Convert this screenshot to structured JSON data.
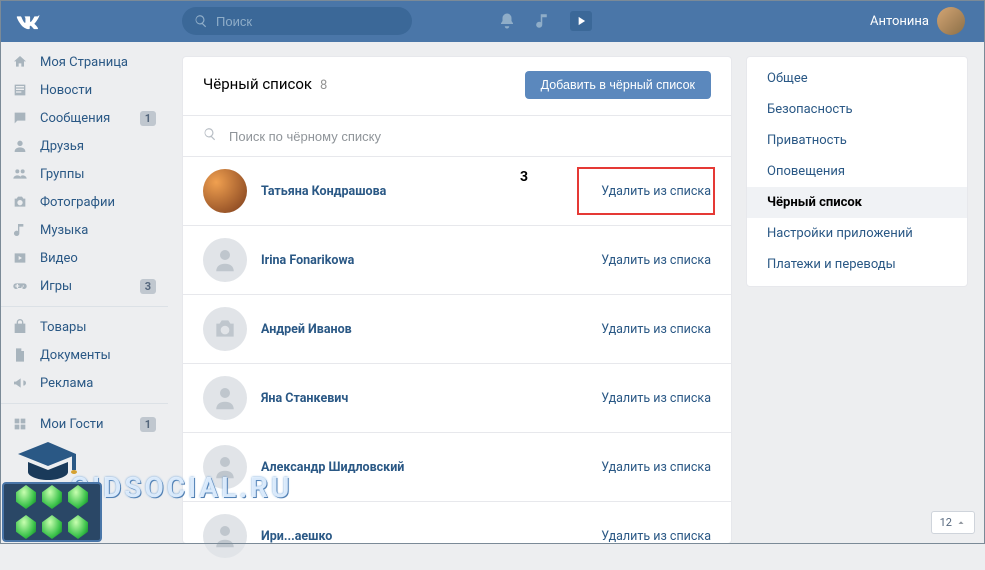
{
  "header": {
    "search_placeholder": "Поиск",
    "username": "Антонина"
  },
  "leftnav": {
    "items": [
      {
        "id": "mypage",
        "label": "Моя Страница",
        "icon": "home"
      },
      {
        "id": "news",
        "label": "Новости",
        "icon": "news"
      },
      {
        "id": "messages",
        "label": "Сообщения",
        "icon": "chat",
        "badge": "1"
      },
      {
        "id": "friends",
        "label": "Друзья",
        "icon": "user"
      },
      {
        "id": "groups",
        "label": "Группы",
        "icon": "users"
      },
      {
        "id": "photos",
        "label": "Фотографии",
        "icon": "camera"
      },
      {
        "id": "music",
        "label": "Музыка",
        "icon": "music"
      },
      {
        "id": "video",
        "label": "Видео",
        "icon": "video"
      },
      {
        "id": "games",
        "label": "Игры",
        "icon": "gamepad",
        "badge": "3"
      }
    ],
    "items2": [
      {
        "id": "market",
        "label": "Товары",
        "icon": "bag"
      },
      {
        "id": "docs",
        "label": "Документы",
        "icon": "doc"
      },
      {
        "id": "ads",
        "label": "Реклама",
        "icon": "megaphone"
      }
    ],
    "items3": [
      {
        "id": "guests",
        "label": "Мои Гости",
        "icon": "grid",
        "badge": "1"
      }
    ]
  },
  "blacklist": {
    "title": "Чёрный список",
    "count": "8",
    "add_button": "Добавить в чёрный список",
    "search_placeholder": "Поиск по чёрному списку",
    "remove_label": "Удалить из списка",
    "annotation": "3",
    "people": [
      {
        "name": "Татьяна Кондрашова",
        "avatar": "photo",
        "highlighted": true
      },
      {
        "name": "Irina Fonarikowa",
        "avatar": "deactivated"
      },
      {
        "name": "Андрей Иванов",
        "avatar": "camera"
      },
      {
        "name": "Яна Станкевич",
        "avatar": "deactivated"
      },
      {
        "name": "Александр Шидловский",
        "avatar": "deactivated"
      },
      {
        "name": "Ири...аешко",
        "avatar": "deactivated"
      }
    ]
  },
  "settings_nav": {
    "items": [
      {
        "id": "general",
        "label": "Общее"
      },
      {
        "id": "security",
        "label": "Безопасность"
      },
      {
        "id": "privacy",
        "label": "Приватность"
      },
      {
        "id": "notifications",
        "label": "Оповещения"
      },
      {
        "id": "blacklist",
        "label": "Чёрный список",
        "active": true
      },
      {
        "id": "apps",
        "label": "Настройки приложений"
      },
      {
        "id": "payments",
        "label": "Платежи и переводы"
      }
    ]
  },
  "watermark": "GIDSOCIAL.RU",
  "notification_count": "12"
}
